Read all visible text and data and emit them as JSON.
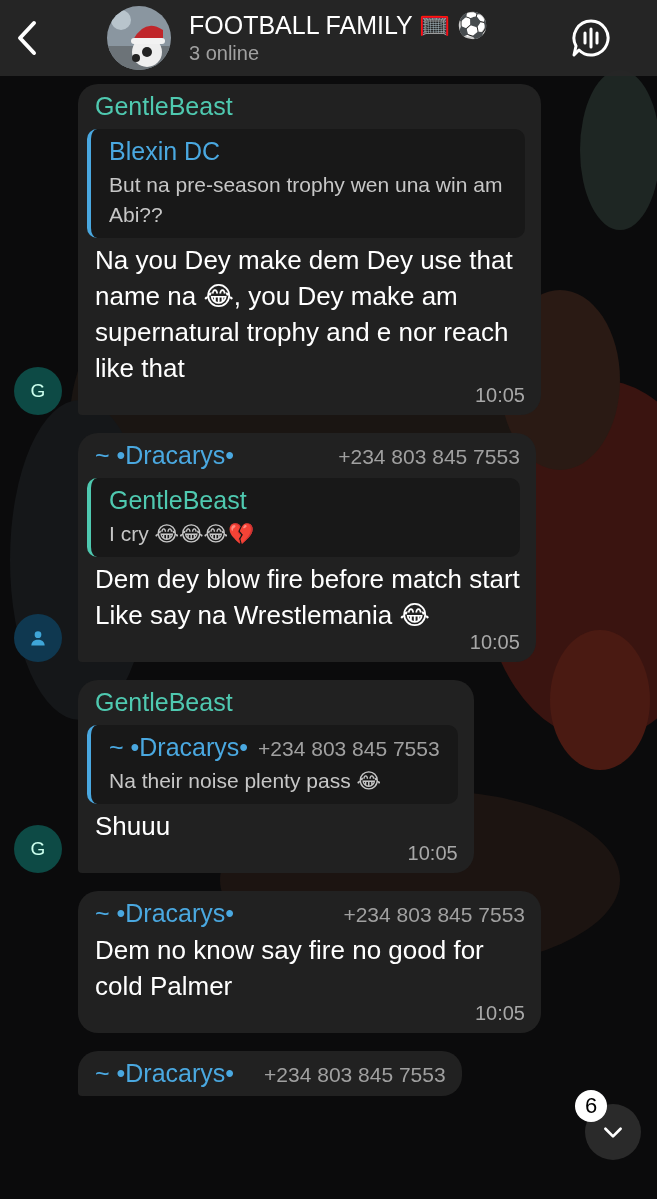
{
  "header": {
    "title": "FOOTBALL FAMILY 🥅 ⚽",
    "subtitle": "3 online"
  },
  "messages": [
    {
      "sender": "GentleBeast",
      "color": "#4fc9b0",
      "reply": {
        "name": "Blexin DC",
        "color": "#4aa8e0",
        "text": "But na pre-season trophy wen una win am Abi??"
      },
      "text": "Na you Dey make dem Dey use that name na 😂, you Dey make am supernatural trophy and e nor reach like that",
      "time": "10:05",
      "avatar": {
        "kind": "letter",
        "letter": "G"
      }
    },
    {
      "sender": "~ •Dracarys•",
      "color": "#4aa8e0",
      "phone": "+234 803 845 7553",
      "reply": {
        "name": "GentleBeast",
        "color": "#4fc9b0",
        "text": "I cry 😂😂😂💔"
      },
      "text": "Dem dey blow fire before match start\nLike say na Wrestlemania 😂",
      "time": "10:05",
      "avatar": {
        "kind": "person"
      }
    },
    {
      "sender": "GentleBeast",
      "color": "#4fc9b0",
      "reply": {
        "name": "~ •Dracarys•",
        "color": "#4aa8e0",
        "phone": "+234 803 845 7553",
        "text": "Na their noise plenty pass 😂"
      },
      "text": "Shuuu",
      "time": "10:05",
      "avatar": {
        "kind": "letter",
        "letter": "G"
      }
    },
    {
      "sender": "~ •Dracarys•",
      "color": "#4aa8e0",
      "phone": "+234 803 845 7553",
      "text": "Dem no know say fire no good for cold Palmer",
      "time": "10:05"
    },
    {
      "sender": "~ •Dracarys•",
      "color": "#4aa8e0",
      "phone": "+234 803 845 7553"
    }
  ],
  "scroll_button": {
    "badge": "6"
  }
}
